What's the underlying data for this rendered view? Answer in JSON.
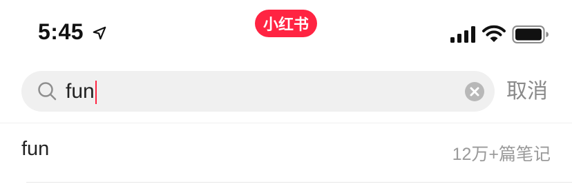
{
  "status_bar": {
    "time": "5:45",
    "app_badge": "小红书"
  },
  "search": {
    "query": "fun",
    "cancel_label": "取消"
  },
  "suggestions": [
    {
      "term": "fun",
      "count": "12万+篇笔记"
    }
  ],
  "colors": {
    "brand": "#ff2442",
    "search_bg": "#f0f0f0",
    "muted_text": "#8a8a8a"
  },
  "icons": [
    "location-arrow-icon",
    "signal-icon",
    "wifi-icon",
    "battery-icon",
    "search-icon",
    "clear-icon"
  ]
}
